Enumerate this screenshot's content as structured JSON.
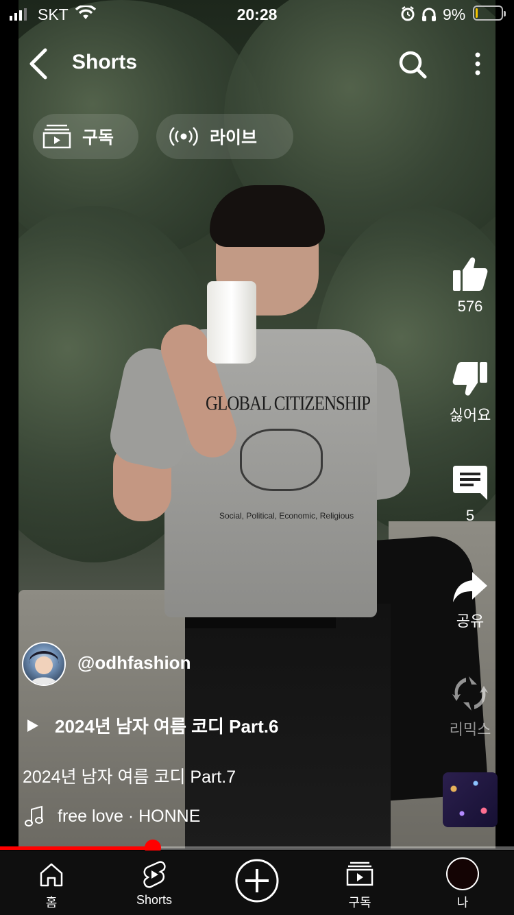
{
  "status_bar": {
    "carrier": "SKT",
    "time": "20:28",
    "battery_percent": "9%",
    "battery_level": 0.09,
    "battery_color": "#f5c400",
    "icons": [
      "signal-icon",
      "wifi-icon",
      "alarm-icon",
      "headphones-icon",
      "battery-icon"
    ]
  },
  "header": {
    "title": "Shorts",
    "back_icon": "chevron-left-icon",
    "search_icon": "search-icon",
    "more_icon": "more-vertical-icon"
  },
  "tabs": [
    {
      "label": "구독",
      "icon": "subscriptions-icon"
    },
    {
      "label": "라이브",
      "icon": "live-icon"
    }
  ],
  "video_print": {
    "title": "GLOBAL CITIZENSHIP",
    "subtitle": "Social, Political, Economic, Religious"
  },
  "actions": {
    "like": {
      "label": "576",
      "icon": "thumbs-up-icon"
    },
    "dislike": {
      "label": "싫어요",
      "icon": "thumbs-down-icon"
    },
    "comments": {
      "label": "5",
      "icon": "comment-icon"
    },
    "share": {
      "label": "공유",
      "icon": "share-icon"
    },
    "remix": {
      "label": "리믹스",
      "icon": "remix-icon"
    }
  },
  "video_info": {
    "channel": "@odhfashion",
    "related_video": "2024년 남자 여름 코디 Part.6",
    "description": "2024년 남자 여름 코디 Part.7",
    "music": "free love · HONNE"
  },
  "progress": {
    "played_fraction": 0.29,
    "color": "#ff0000"
  },
  "bottom_nav": [
    {
      "label": "홈",
      "icon": "home-icon"
    },
    {
      "label": "Shorts",
      "icon": "shorts-icon"
    },
    {
      "label": "",
      "icon": "create-plus-icon"
    },
    {
      "label": "구독",
      "icon": "subscriptions-icon"
    },
    {
      "label": "나",
      "icon": "profile-avatar-icon"
    }
  ]
}
